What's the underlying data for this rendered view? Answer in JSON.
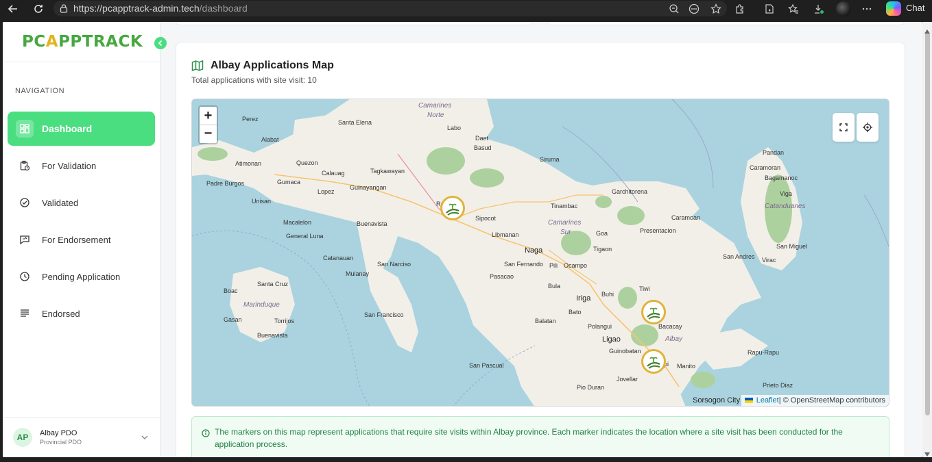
{
  "browser": {
    "url_prefix": "https://",
    "url_host": "pcapptrack-admin.tech",
    "url_path": "/dashboard",
    "chat_label": "Chat"
  },
  "sidebar": {
    "logo_left": "PC",
    "logo_a": "A",
    "logo_right": "PPTRACK",
    "nav_title": "NAVIGATION",
    "items": [
      {
        "label": "Dashboard",
        "icon": "dashboard-icon",
        "active": true
      },
      {
        "label": "For Validation",
        "icon": "clipboard-clock-icon"
      },
      {
        "label": "Validated",
        "icon": "check-circle-icon"
      },
      {
        "label": "For Endorsement",
        "icon": "message-send-icon"
      },
      {
        "label": "Pending Application",
        "icon": "clock-icon"
      },
      {
        "label": "Endorsed",
        "icon": "list-icon"
      }
    ],
    "user": {
      "initials": "AP",
      "name": "Albay PDO",
      "role": "Provincial PDO"
    }
  },
  "map_card": {
    "title": "Albay Applications Map",
    "subtitle": "Total applications with site visit: 10",
    "zoom_in": "+",
    "zoom_out": "−",
    "attribution_link": "Leaflet",
    "attribution_text": " | © OpenStreetMap contributors",
    "places": {
      "camarines_norte_1": "Camarines",
      "camarines_norte_2": "Norte",
      "perez": "Perez",
      "santa_elena": "Santa Elena",
      "labo": "Labo",
      "daet": "Daet",
      "basud": "Basud",
      "alabat": "Alabat",
      "atimonan": "Atimonan",
      "quezon": "Quezon",
      "calauag": "Calauag",
      "tagkawayan": "Tagkawayan",
      "siruma": "Siruma",
      "pandan": "Pandan",
      "caramoran": "Caramoran",
      "bagamanoc": "Bagamanoc",
      "padre_burgos": "Padre Burgos",
      "gumaca": "Gumaca",
      "lopez": "Lopez",
      "guinayangan": "Guinayangan",
      "garchitorena": "Garchitorena",
      "viga": "Viga",
      "catanduanes": "Catanduanes",
      "unisan": "Unisan",
      "tinambac": "Tinambac",
      "caramoan": "Caramoan",
      "ra": "Ra",
      "sipocot": "Sipocot",
      "macalelon": "Macalelon",
      "buenavista": "Buenavista",
      "camarines_sur_1": "Camarines",
      "camarines_sur_2": "Sur",
      "goa": "Goa",
      "presentacion": "Presentacion",
      "general_luna": "General Luna",
      "libmanan": "Libmanan",
      "san_miguel": "San Miguel",
      "naga": "Naga",
      "tigaon": "Tigaon",
      "catanauan": "Catanauan",
      "san_andres": "San Andres",
      "virac": "Virac",
      "san_narciso": "San Narciso",
      "san_fernando": "San Fernando",
      "pili": "Pili",
      "ocampo": "Ocampo",
      "mulanay": "Mulanay",
      "pasacao": "Pasacao",
      "santa_cruz": "Santa Cruz",
      "bula": "Bula",
      "tiwi": "Tiwi",
      "boac": "Boac",
      "marinduque": "Marinduque",
      "iriga": "Iriga",
      "buhi": "Buhi",
      "san_francisco": "San Francisco",
      "bato": "Bato",
      "gasan": "Gasan",
      "torrijos": "Torrijos",
      "balatan": "Balatan",
      "bacacay": "Bacacay",
      "polangui": "Polangui",
      "buenavista_m": "Buenavista",
      "ligao": "Ligao",
      "albay": "Albay",
      "guinobatan": "Guinobatan",
      "rapu_rapu": "Rapu-Rapu",
      "san_pascual": "San Pascual",
      "manito": "Manito",
      "jovellar": "Jovellar",
      "prieto_diaz": "Prieto Diaz",
      "pio_duran": "Pio Duran",
      "sorsogon_city": "Sorsogon City",
      "pi": "pi"
    }
  },
  "info": {
    "text": "The markers on this map represent applications that require site visits within Albay province. Each marker indicates the location where a site visit has been conducted for the application process."
  },
  "colors": {
    "brand_green": "#4ade80",
    "logo_green": "#46a83f",
    "logo_yellow": "#e4b321",
    "info_text": "#218143",
    "water": "#a9cfd9",
    "land": "#f2efe9"
  }
}
